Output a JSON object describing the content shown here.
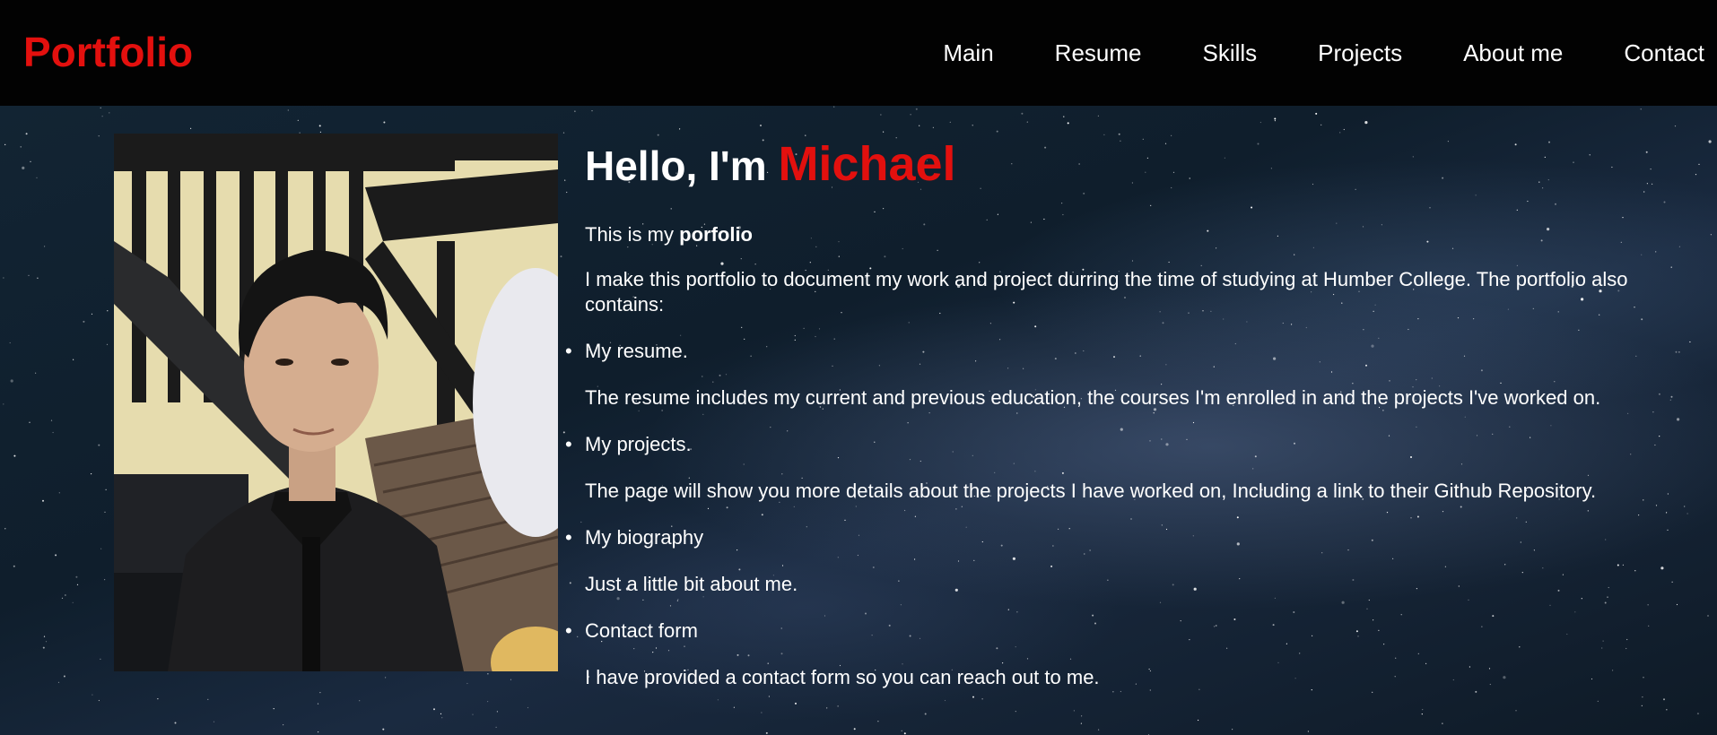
{
  "header": {
    "logo": "Portfolio",
    "nav": [
      "Main",
      "Resume",
      "Skills",
      "Projects",
      "About me",
      "Contact"
    ]
  },
  "hero": {
    "greeting": "Hello, I'm ",
    "name": "Michael",
    "intro_prefix": "This is my ",
    "intro_bold": "porfolio",
    "description": "I make this portfolio to document my work and project durring the time of studying at Humber College. The portfolio also contains:",
    "items": [
      {
        "title": "My resume.",
        "detail": "The resume includes my current and previous education, the courses I'm enrolled in and the projects I've worked on."
      },
      {
        "title": "My projects.",
        "detail": "The page will show you more details about the projects I have worked on, Including a link to their Github Repository."
      },
      {
        "title": "My biography",
        "detail": "Just a little bit about me."
      },
      {
        "title": "Contact form",
        "detail": "I have provided a contact form so you can reach out to me."
      }
    ],
    "bullet": "•"
  },
  "colors": {
    "accent": "#e3100e",
    "header_bg": "#020202",
    "text": "#ffffff"
  }
}
